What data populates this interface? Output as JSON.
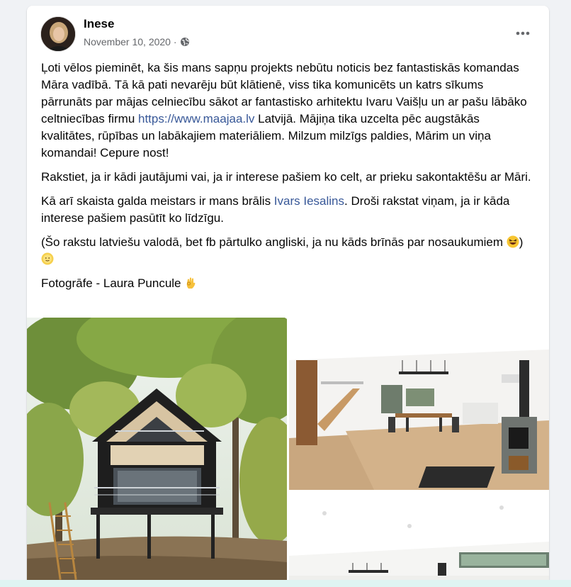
{
  "post": {
    "author": "Inese",
    "date": "November 10, 2020 ·",
    "privacy_icon": "globe-icon",
    "more_icon": "more-options-icon",
    "paragraphs": {
      "p1_before_link": "Ļoti vēlos pieminēt, ka šis mans sapņu projekts nebūtu noticis bez fantastiskās komandas Māra vadībā.  Tā kā pati nevarēju būt klātienē, viss tika komunicēts un katrs sīkums pārrunāts par mājas celniecību sākot ar fantastisko arhitektu Ivaru Vaišļu un ar pašu lābāko celtniecības firmu ",
      "p1_link": "https://www.maajaa.lv",
      "p1_after_link": " Latvijā.  Mājiņa tika uzcelta pēc augstākās kvalitātes, rūpības un labākajiem materiāliem. Milzum milzīgs paldies, Mārim un viņa komandai! Cepure nost!",
      "p2": "Rakstiet, ja ir kādi jautājumi vai, ja ir interese pašiem ko celt, ar prieku sakontaktēšu ar Māri.",
      "p3_before_link": "Kā arī skaista galda meistars ir mans brālis ",
      "p3_link": "Ivars Iesalins",
      "p3_after_link": ". Droši rakstat viņam, ja ir kāda interese pašiem pasūtīt ko līdzīgu.",
      "p4": "(Šo rakstu latviešu valodā, bet fb pārtulko angliski, ja nu kāds brīnās par nosaukumiem",
      "p5": "Fotogrāfe - Laura Puncule"
    },
    "emojis": {
      "laugh": "laughing-emoji",
      "sun": "sun-face-emoji",
      "ok": "ok-hand-emoji"
    },
    "colors": {
      "link": "#385898",
      "meta_text": "#65676b",
      "background": "#f0f2f5"
    }
  }
}
